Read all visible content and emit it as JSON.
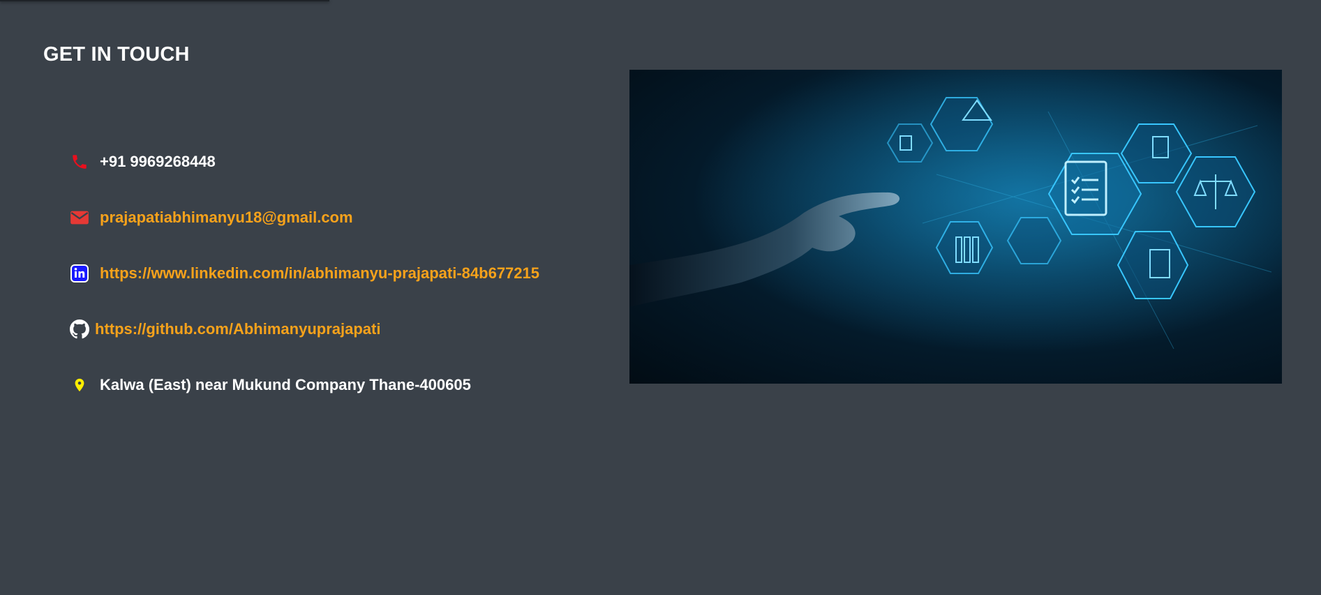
{
  "contact": {
    "title": "GET IN TOUCH",
    "phone": "+91 9969268448",
    "email": "prajapatiabhimanyu18@gmail.com",
    "linkedin": "https://www.linkedin.com/in/abhimanyu-prajapati-84b677215",
    "github": "https://github.com/Abhimanyuprajapati",
    "address": "Kalwa (East) near Mukund Company Thane-400605"
  },
  "icons": {
    "phone": "phone-icon",
    "email": "email-icon",
    "linkedin": "linkedin-icon",
    "github": "github-icon",
    "address": "location-pin-icon"
  },
  "colors": {
    "background": "#3a4149",
    "heading": "#ffffff",
    "link": "#f7a21b",
    "phone_icon": "#e8101e",
    "email_icon": "#e53935",
    "linkedin_icon": "#1a1aff",
    "pin_icon": "#ffee00"
  }
}
